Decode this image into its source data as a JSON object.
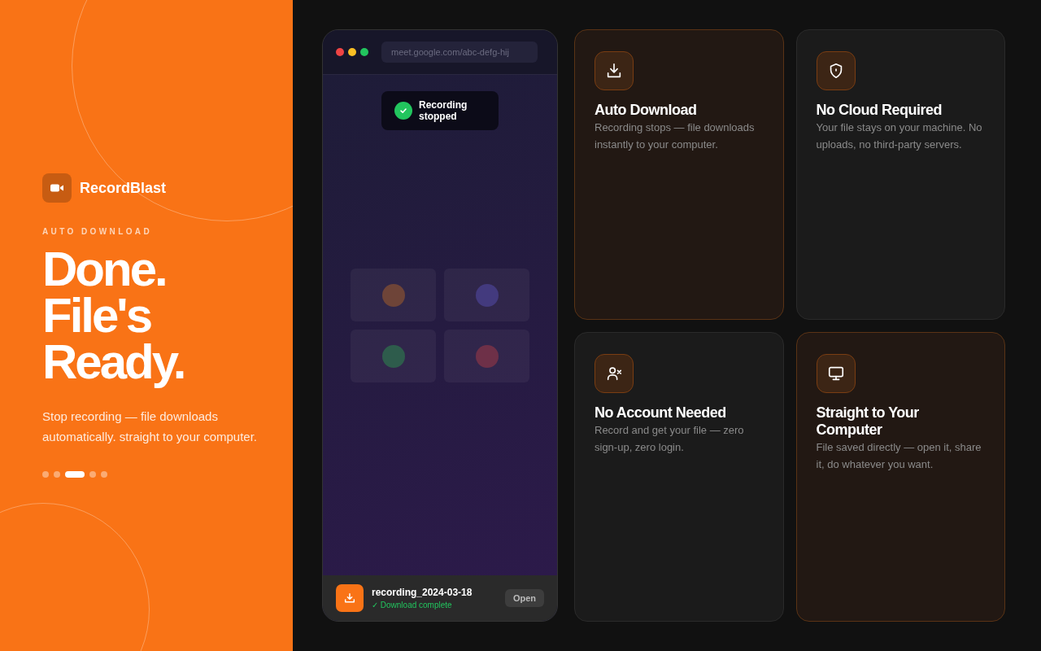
{
  "brand": {
    "name": "RecordBlast"
  },
  "eyebrow": "AUTO DOWNLOAD",
  "headline": [
    "Done.",
    "File's",
    "Ready."
  ],
  "description": "Stop recording — file downloads automatically. straight to your computer.",
  "pagination": [
    {
      "selected": false
    },
    {
      "selected": false
    },
    {
      "selected": true
    },
    {
      "selected": false
    },
    {
      "selected": false
    }
  ],
  "browser": {
    "url": "meet.google.com/abc-defg-hij",
    "toast": "Recording stopped",
    "participants": [
      {
        "color": "#6e4438"
      },
      {
        "color": "#433a7e"
      },
      {
        "color": "#2e5c4c"
      },
      {
        "color": "#6e3048"
      }
    ],
    "download": {
      "filename": "recording_2024-03-18",
      "status": "✓ Download complete",
      "button": "Open"
    }
  },
  "features": [
    {
      "kind": "download",
      "title": "Auto Download",
      "text": "Recording stops — file downloads instantly to your computer.",
      "highlighted": true
    },
    {
      "kind": "shield",
      "title": "No Cloud Required",
      "text": "Your file stays on your machine. No uploads, no third-party servers.",
      "highlighted": false
    },
    {
      "kind": "user-x",
      "title": "No Account Needed",
      "text": "Record and get your file — zero sign-up, zero login.",
      "highlighted": false
    },
    {
      "kind": "monitor",
      "title": "Straight to Your Computer",
      "text": "File saved directly — open it, share it, do whatever you want.",
      "highlighted": true
    }
  ]
}
